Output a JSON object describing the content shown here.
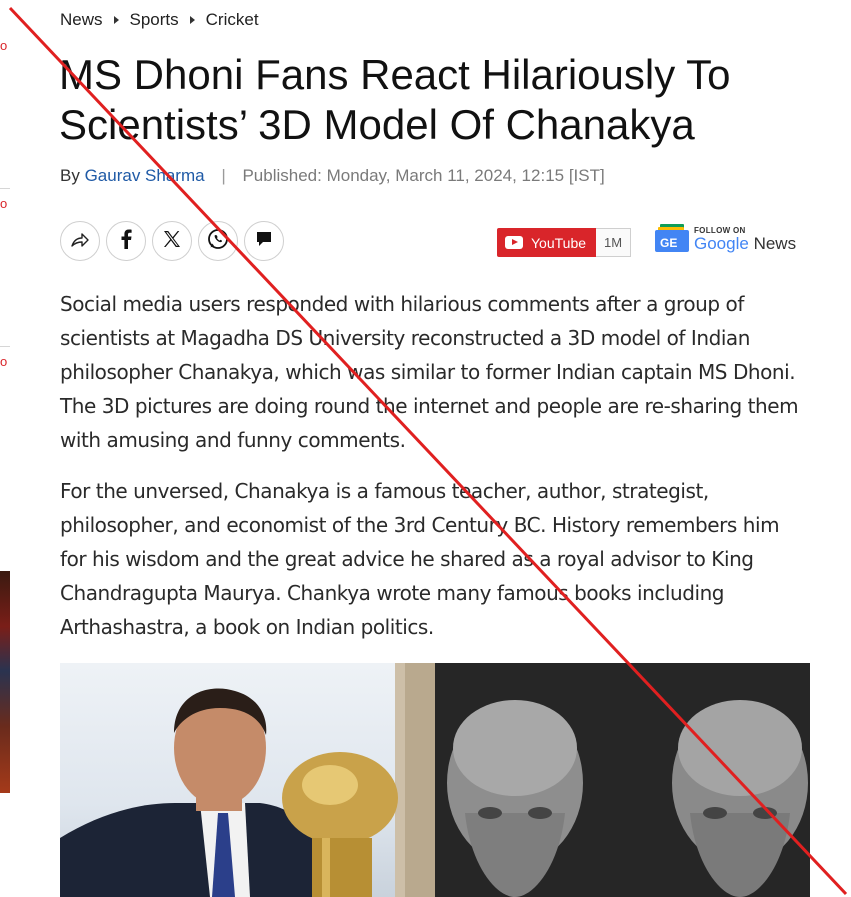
{
  "breadcrumb": {
    "items": [
      "News",
      "Sports",
      "Cricket"
    ]
  },
  "article": {
    "title": "MS Dhoni Fans React Hilariously To Scientists’ 3D Model Of Chanakya",
    "byline": {
      "prefix": "By",
      "author": "Gaurav Sharma",
      "separator": "|",
      "published": "Published: Monday, March 11, 2024, 12:15 [IST]"
    },
    "paragraphs": [
      "Social media users responded with hilarious comments after a group of scientists at Magadha DS University reconstructed a 3D model of Indian philosopher Chanakya, which was similar to former Indian captain MS Dhoni. The 3D pictures are doing round the internet and people are re-sharing them with amusing and funny comments.",
      "For the unversed, Chanakya is a famous teacher, author, strategist, philosopher, and economist of the 3rd Century BC. History remembers him for his wisdom and the great advice he shared as a royal advisor to King Chandragupta Maurya. Chankya wrote many famous books including Arthashastra, a book on Indian politics."
    ]
  },
  "share": {
    "icons": [
      "share-icon",
      "facebook-icon",
      "x-icon",
      "whatsapp-icon",
      "comment-icon"
    ]
  },
  "youtube": {
    "label": "YouTube",
    "count": "1M",
    "color": "#d9252a"
  },
  "google_news": {
    "follow": "FOLLOW ON",
    "google": "Google",
    "news": "News"
  },
  "left_edge": {
    "marks": [
      "o",
      "o",
      "o"
    ]
  },
  "colors": {
    "accent": "#d9252a",
    "author_link": "#1f5aa6"
  }
}
